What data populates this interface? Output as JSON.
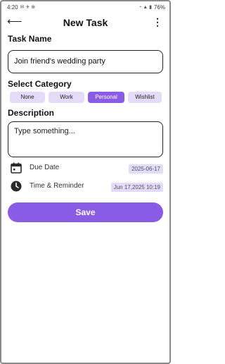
{
  "status_bar": {
    "time": "4:20",
    "battery": "76%"
  },
  "app_bar": {
    "title": "New Task",
    "back_icon": "arrow-left-icon",
    "more_icon": "more-vert-icon"
  },
  "task_name": {
    "label": "Task Name",
    "value": "Join friend's wedding party"
  },
  "category": {
    "label": "Select Category",
    "options": [
      "None",
      "Work",
      "Personal",
      "Wishlist"
    ],
    "selected": "Personal"
  },
  "description": {
    "label": "Description",
    "placeholder": "Type something..."
  },
  "due_date": {
    "label": "Due Date",
    "value": "2025-06-17",
    "icon": "calendar-icon"
  },
  "reminder": {
    "label": "Time & Reminder",
    "value": "Jun 17,2025  10:19",
    "icon": "clock-icon"
  },
  "save_label": "Save",
  "colors": {
    "accent": "#8a5ce6",
    "chip_bg": "#e3dcf8"
  }
}
